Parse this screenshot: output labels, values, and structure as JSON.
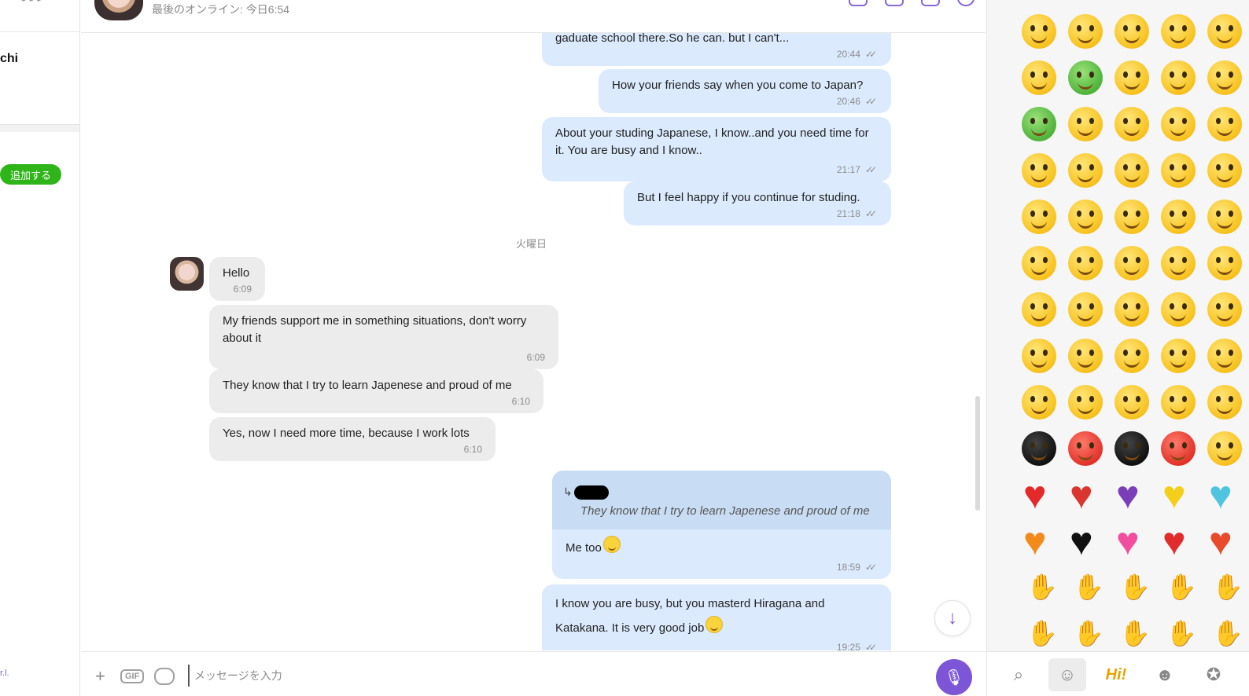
{
  "sidebar": {
    "contact_name": "chi",
    "add_button": "追加する",
    "footer_text": "r.l."
  },
  "header": {
    "last_online": "最後のオンライン: 今日6:54"
  },
  "messages": [
    {
      "dir": "out",
      "text": "gaduate school there.So he can. but I can't...",
      "time": "20:44"
    },
    {
      "dir": "out",
      "text": "How your friends say when you come to Japan?",
      "time": "20:46"
    },
    {
      "dir": "out",
      "text": "About your studing Japanese, I know..and you need time for it. You are busy and I know..",
      "time": "21:17"
    },
    {
      "dir": "out",
      "text": "But I feel happy if you continue for studing.",
      "time": "21:18"
    },
    {
      "dir": "in",
      "text": "Hello",
      "time": "6:09"
    },
    {
      "dir": "in",
      "text": "My friends support me in something situations, don't worry about it",
      "time": "6:09"
    },
    {
      "dir": "in",
      "text": "They know that I try to learn Japenese and proud of me",
      "time": "6:10"
    },
    {
      "dir": "in",
      "text": "Yes, now I need more time, because I work lots",
      "time": "6:10"
    },
    {
      "dir": "out",
      "reply_quote": "They know that I try to learn Japenese and proud of me",
      "text": "Me too",
      "time": "18:59"
    },
    {
      "dir": "out",
      "text": "I know you are busy, but you masterd Hiragana and Katakana. It is very good job",
      "time": "19:25"
    }
  ],
  "day_separator": "火曜日",
  "input": {
    "placeholder": "メッセージを入力"
  },
  "colors": {
    "accent": "#7c56d6",
    "outgoing_bubble": "#dbeafd",
    "incoming_bubble": "#ececec",
    "add_button": "#2fb51a"
  },
  "emoji_panel": {
    "tabs": [
      "search-icon",
      "smiley-icon",
      "hi-sticker-icon",
      "boy-sticker-icon",
      "sticker-pack-icon"
    ],
    "hi_label": "Hi!"
  }
}
